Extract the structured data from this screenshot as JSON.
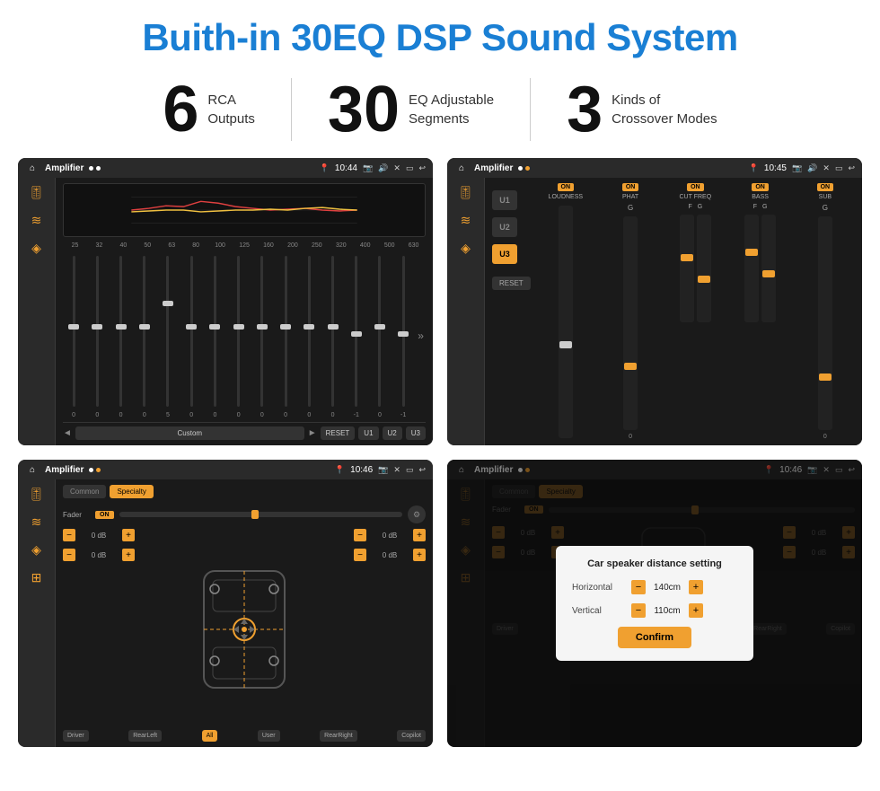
{
  "header": {
    "title": "Buith-in 30EQ DSP Sound System"
  },
  "stats": [
    {
      "number": "6",
      "line1": "RCA",
      "line2": "Outputs"
    },
    {
      "number": "30",
      "line1": "EQ Adjustable",
      "line2": "Segments"
    },
    {
      "number": "3",
      "line1": "Kinds of",
      "line2": "Crossover Modes"
    }
  ],
  "screens": [
    {
      "id": "eq-screen",
      "time": "10:44",
      "app": "Amplifier",
      "type": "eq"
    },
    {
      "id": "crossover-screen",
      "time": "10:45",
      "app": "Amplifier",
      "type": "crossover"
    },
    {
      "id": "fader-screen",
      "time": "10:46",
      "app": "Amplifier",
      "type": "fader"
    },
    {
      "id": "distance-screen",
      "time": "10:46",
      "app": "Amplifier",
      "type": "distance"
    }
  ],
  "eq": {
    "frequencies": [
      "25",
      "32",
      "40",
      "50",
      "63",
      "80",
      "100",
      "125",
      "160",
      "200",
      "250",
      "320",
      "400",
      "500",
      "630"
    ],
    "values": [
      "0",
      "0",
      "0",
      "0",
      "5",
      "0",
      "0",
      "0",
      "0",
      "0",
      "0",
      "0",
      "-1",
      "0",
      "-1"
    ],
    "preset": "Custom",
    "buttons": [
      "RESET",
      "U1",
      "U2",
      "U3"
    ]
  },
  "crossover": {
    "presets": [
      "U1",
      "U2",
      "U3"
    ],
    "channels": [
      "LOUDNESS",
      "PHAT",
      "CUT FREQ",
      "BASS",
      "SUB"
    ],
    "reset_label": "RESET"
  },
  "fader": {
    "tabs": [
      "Common",
      "Specialty"
    ],
    "active_tab": "Specialty",
    "fader_label": "Fader",
    "db_values": [
      "0 dB",
      "0 dB",
      "0 dB",
      "0 dB"
    ],
    "speaker_labels": [
      "Driver",
      "RearLeft",
      "All",
      "User",
      "RearRight",
      "Copilot"
    ]
  },
  "distance_dialog": {
    "title": "Car speaker distance setting",
    "horizontal_label": "Horizontal",
    "horizontal_value": "140cm",
    "vertical_label": "Vertical",
    "vertical_value": "110cm",
    "confirm_label": "Confirm",
    "db_values": [
      "0 dB",
      "0 dB"
    ]
  }
}
